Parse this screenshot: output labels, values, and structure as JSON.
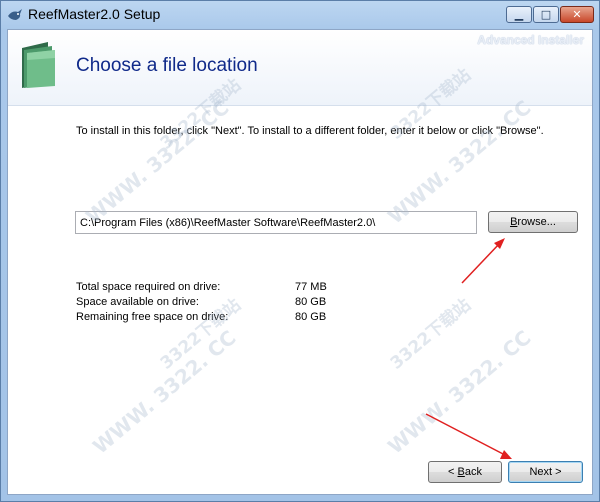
{
  "window": {
    "title": "ReefMaster2.0 Setup",
    "minimize_glyph": "▁",
    "maximize_glyph": "□",
    "close_glyph": "✕"
  },
  "header": {
    "brand": "Advanced Installer",
    "page_title": "Choose a file location",
    "icon": "folder-icon"
  },
  "instructions": "To install in this folder, click \"Next\". To install to a different folder, enter it below or click \"Browse\".",
  "path": {
    "value": "C:\\Program Files (x86)\\ReefMaster Software\\ReefMaster2.0\\"
  },
  "buttons": {
    "browse_underlined": "B",
    "browse_rest": "rowse...",
    "back_prefix": "< ",
    "back_underlined": "B",
    "back_rest": "ack",
    "next": "Next >"
  },
  "space": [
    {
      "label": "Total space required on drive:",
      "value": "77 MB"
    },
    {
      "label": "Space available on drive:",
      "value": "80 GB"
    },
    {
      "label": "Remaining free space on drive:",
      "value": "80 GB"
    }
  ],
  "watermark": "WWW. 3322. CC",
  "watermark_cjk": "3322下载站",
  "colors": {
    "title_blue": "#102a8a",
    "arrow_red": "#e02020"
  }
}
